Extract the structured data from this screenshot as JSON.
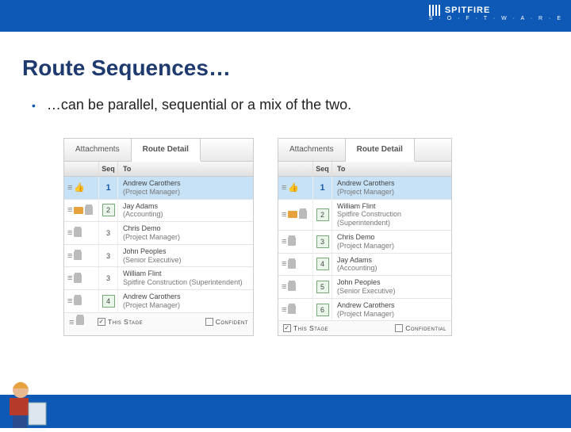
{
  "brand": {
    "name": "SPITFIRE",
    "sub": "S · O · F · T · W · A · R · E"
  },
  "title": "Route Sequences…",
  "bullet": "…can be parallel, sequential or a mix of the two.",
  "tabs": {
    "attachments": "Attachments",
    "routeDetail": "Route Detail"
  },
  "headers": {
    "seq": "Seq",
    "to": "To"
  },
  "footer": {
    "thisStage": "This Stage",
    "confidential": "Confidential",
    "confidentialShort": "Confident"
  },
  "panelA": {
    "rows": [
      {
        "seq": "1",
        "name": "Andrew Carothers",
        "role": "(Project Manager)",
        "current": true,
        "icons": [
          "drag",
          "thumb"
        ]
      },
      {
        "seq": "2",
        "name": "Jay Adams",
        "role": "(Accounting)",
        "boxed": true,
        "icons": [
          "drag",
          "folder",
          "trash"
        ]
      },
      {
        "seq": "3",
        "name": "Chris Demo",
        "role": "(Project Manager)",
        "icons": [
          "drag",
          "trash"
        ]
      },
      {
        "seq": "3",
        "name": "John Peoples",
        "role": "(Senior Executive)",
        "icons": [
          "drag",
          "trash"
        ]
      },
      {
        "seq": "3",
        "name": "William Flint",
        "role": "Spitfire Construction (Superintendent)",
        "icons": [
          "drag",
          "trash"
        ]
      },
      {
        "seq": "4",
        "name": "Andrew Carothers",
        "role": "(Project Manager)",
        "boxed": true,
        "icons": [
          "drag",
          "trash"
        ]
      }
    ]
  },
  "panelB": {
    "rows": [
      {
        "seq": "1",
        "name": "Andrew Carothers",
        "role": "(Project Manager)",
        "current": true,
        "icons": [
          "drag",
          "thumb"
        ]
      },
      {
        "seq": "2",
        "name": "William Flint",
        "role": "Spitfire Construction (Superintendent)",
        "boxed": true,
        "icons": [
          "drag",
          "folder",
          "trash"
        ]
      },
      {
        "seq": "3",
        "name": "Chris Demo",
        "role": "(Project Manager)",
        "boxed": true,
        "icons": [
          "drag",
          "trash"
        ]
      },
      {
        "seq": "4",
        "name": "Jay Adams",
        "role": "(Accounting)",
        "boxed": true,
        "icons": [
          "drag",
          "trash"
        ]
      },
      {
        "seq": "5",
        "name": "John Peoples",
        "role": "(Senior Executive)",
        "boxed": true,
        "icons": [
          "drag",
          "trash"
        ]
      },
      {
        "seq": "6",
        "name": "Andrew Carothers",
        "role": "(Project Manager)",
        "boxed": true,
        "icons": [
          "drag",
          "trash"
        ]
      }
    ]
  }
}
